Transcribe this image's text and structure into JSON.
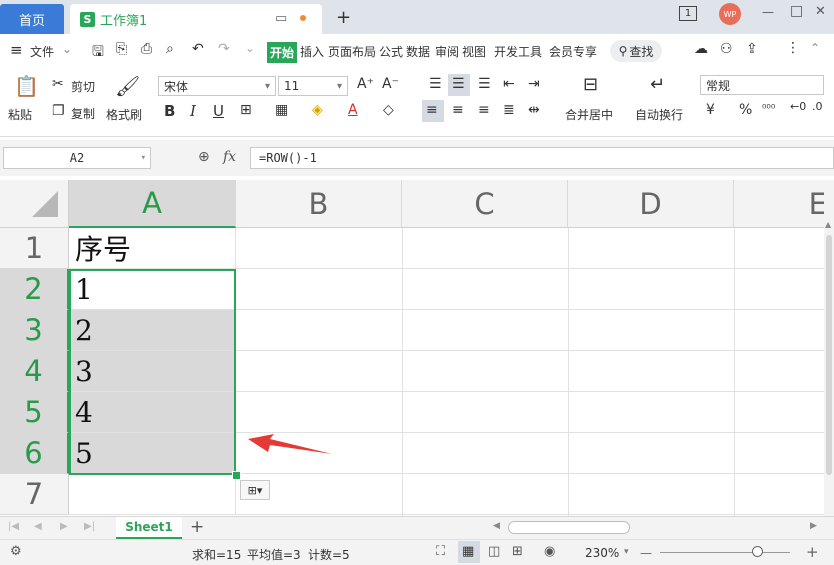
{
  "titlebar": {
    "home_tab": "首页",
    "doc_icon": "S",
    "doc_title": "工作簿1",
    "new_tab_symbol": "+",
    "page_badge": "1",
    "avatar_text": "WP",
    "min_symbol": "—",
    "max_symbol": "□",
    "close_symbol": "✕"
  },
  "menu": {
    "hamburger": "≡",
    "file": "文件",
    "tabs": [
      "开始",
      "插入",
      "页面布局",
      "公式",
      "数据",
      "审阅",
      "视图",
      "开发工具",
      "会员专享"
    ],
    "search": "查找"
  },
  "ribbon": {
    "paste": "粘贴",
    "cut": "剪切",
    "copy": "复制",
    "format_painter": "格式刷",
    "font_name": "宋体",
    "font_size": "11",
    "bold": "B",
    "italic": "I",
    "underline": "U",
    "merge": "合并居中",
    "wrap": "自动换行",
    "number_format": "常规",
    "currency": "¥",
    "percent": "%"
  },
  "formula_bar": {
    "name_box": "A2",
    "fx": "fx",
    "formula": "=ROW()-1"
  },
  "sheet": {
    "columns": [
      "A",
      "B",
      "C",
      "D",
      "E"
    ],
    "rows": [
      "1",
      "2",
      "3",
      "4",
      "5",
      "6",
      "7"
    ],
    "cells": [
      "序号",
      "1",
      "2",
      "3",
      "4",
      "5",
      ""
    ]
  },
  "tabs_bar": {
    "sheet_name": "Sheet1",
    "add_sheet": "+"
  },
  "status": {
    "sum": "求和=15",
    "average": "平均值=3",
    "count": "计数=5",
    "zoom": "230%",
    "zoom_minus": "—",
    "zoom_plus": "+"
  },
  "colors": {
    "accent_green": "#2aa65a",
    "home_blue": "#3b7bd8",
    "arrow_red": "#e53935"
  }
}
